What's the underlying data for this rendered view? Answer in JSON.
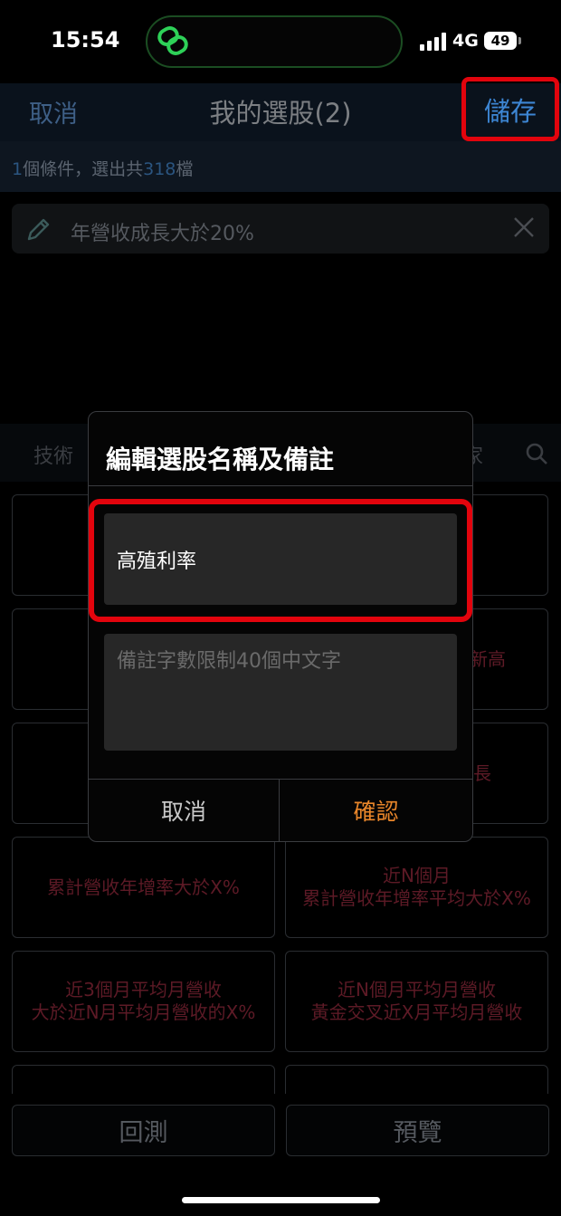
{
  "status_bar": {
    "time": "15:54",
    "network": "4G",
    "battery": "49"
  },
  "nav": {
    "cancel_label": "取消",
    "title": "我的選股(2)",
    "save_label": "儲存"
  },
  "summary": {
    "prefix": "1",
    "middle": "個條件，選出共",
    "count": "318",
    "suffix": "檔"
  },
  "condition": {
    "text": "年營收成長大於20%"
  },
  "tabs": [
    {
      "label": "技術"
    },
    {
      "label": "家"
    }
  ],
  "cards": [
    {
      "label": ""
    },
    {
      "label": ""
    },
    {
      "label": ""
    },
    {
      "label": "新高"
    },
    {
      "label": ""
    },
    {
      "label": "長"
    },
    {
      "label": "累計營收年增率大於X%"
    },
    {
      "label": "近N個月\n累計營收年增率平均大於X%"
    },
    {
      "label": "近3個月平均月營收\n大於近N月平均月營收的X%"
    },
    {
      "label": "近N個月平均月營收\n黃金交叉近X月平均月營收"
    },
    {
      "label": ""
    },
    {
      "label": ""
    }
  ],
  "bottom": {
    "backtest_label": "回測",
    "preview_label": "預覽"
  },
  "dialog": {
    "title": "編輯選股名稱及備註",
    "name_value": "高殖利率",
    "note_placeholder": "備註字數限制40個中文字",
    "cancel_label": "取消",
    "confirm_label": "確認"
  },
  "colors": {
    "accent_blue": "#3d86d4",
    "highlight_red": "#e2040d",
    "confirm_orange": "#e9862a"
  }
}
